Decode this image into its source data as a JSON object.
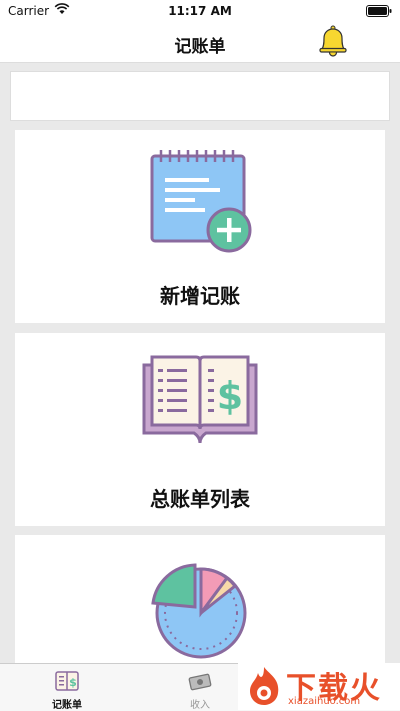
{
  "status_bar": {
    "carrier": "Carrier",
    "time": "11:17 AM"
  },
  "nav": {
    "title": "记账单",
    "bell_icon": "bell-icon",
    "bell_color": "#F7D730"
  },
  "cards": [
    {
      "label": "新增记账",
      "icon": "add-notebook-icon"
    },
    {
      "label": "总账单列表",
      "icon": "ledger-book-icon"
    },
    {
      "label": "",
      "icon": "pie-chart-icon"
    }
  ],
  "tabs": [
    {
      "label": "记账单",
      "icon": "notebook-icon",
      "active": true
    },
    {
      "label": "收入",
      "icon": "money-icon",
      "active": false
    }
  ],
  "watermark": {
    "text": "下载火",
    "url": "xiazaihuo.com",
    "color": "#E8502A"
  }
}
